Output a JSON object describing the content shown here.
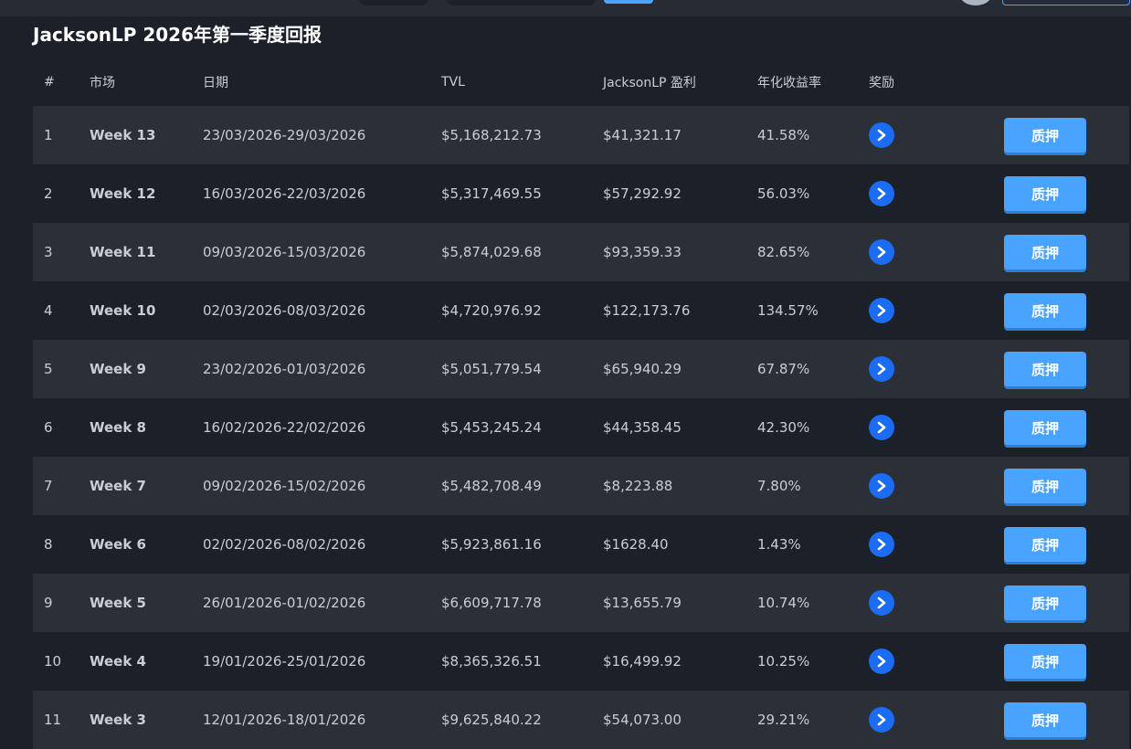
{
  "page": {
    "title": "JacksonLP 2026年第一季度回报"
  },
  "table": {
    "headers": [
      "#",
      "市场",
      "日期",
      "TVL",
      "JacksonLP 盈利",
      "年化收益率",
      "奖励"
    ],
    "rows": [
      {
        "num": "1",
        "market": "Week 13",
        "date": "23/03/2026-29/03/2026",
        "tvl": "$5,168,212.73",
        "profit": "$41,321.17",
        "apr": "41.58%",
        "action": "质押"
      },
      {
        "num": "2",
        "market": "Week 12",
        "date": "16/03/2026-22/03/2026",
        "tvl": "$5,317,469.55",
        "profit": "$57,292.92",
        "apr": "56.03%",
        "action": "质押"
      },
      {
        "num": "3",
        "market": "Week 11",
        "date": "09/03/2026-15/03/2026",
        "tvl": "$5,874,029.68",
        "profit": "$93,359.33",
        "apr": "82.65%",
        "action": "质押"
      },
      {
        "num": "4",
        "market": "Week 10",
        "date": "02/03/2026-08/03/2026",
        "tvl": "$4,720,976.92",
        "profit": "$122,173.76",
        "apr": "134.57%",
        "action": "质押"
      },
      {
        "num": "5",
        "market": "Week 9",
        "date": "23/02/2026-01/03/2026",
        "tvl": "$5,051,779.54",
        "profit": "$65,940.29",
        "apr": "67.87%",
        "action": "质押"
      },
      {
        "num": "6",
        "market": "Week 8",
        "date": "16/02/2026-22/02/2026",
        "tvl": "$5,453,245.24",
        "profit": "$44,358.45",
        "apr": "42.30%",
        "action": "质押"
      },
      {
        "num": "7",
        "market": "Week 7",
        "date": "09/02/2026-15/02/2026",
        "tvl": "$5,482,708.49",
        "profit": "$8,223.88",
        "apr": "7.80%",
        "action": "质押"
      },
      {
        "num": "8",
        "market": "Week 6",
        "date": "02/02/2026-08/02/2026",
        "tvl": "$5,923,861.16",
        "profit": "$1628.40",
        "apr": "1.43%",
        "action": "质押"
      },
      {
        "num": "9",
        "market": "Week 5",
        "date": "26/01/2026-01/02/2026",
        "tvl": "$6,609,717.78",
        "profit": "$13,655.79",
        "apr": "10.74%",
        "action": "质押"
      },
      {
        "num": "10",
        "market": "Week 4",
        "date": "19/01/2026-25/01/2026",
        "tvl": "$8,365,326.51",
        "profit": "$16,499.92",
        "apr": "10.25%",
        "action": "质押"
      },
      {
        "num": "11",
        "market": "Week 3",
        "date": "12/01/2026-18/01/2026",
        "tvl": "$9,625,840.22",
        "profit": "$54,073.00",
        "apr": "29.21%",
        "action": "质押"
      }
    ]
  },
  "icons": {
    "reward": "reward-token-icon"
  },
  "colors": {
    "background": "#1b2029",
    "row_alt": "#2a2f38",
    "button": "#4aa3ff",
    "reward_icon": "#1b6cf2"
  }
}
